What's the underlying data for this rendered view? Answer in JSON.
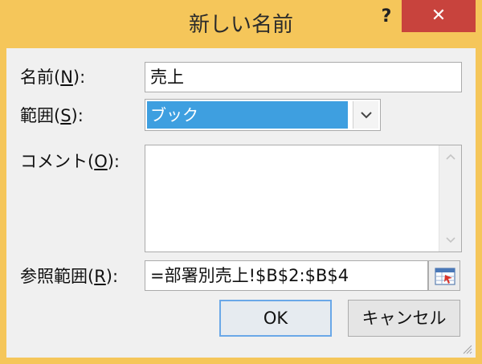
{
  "window": {
    "title": "新しい名前",
    "help": "?",
    "close": "✕"
  },
  "form": {
    "name": {
      "label_pre": "名前(",
      "label_key": "N",
      "label_post": "):",
      "value": "売上"
    },
    "scope": {
      "label_pre": "範囲(",
      "label_key": "S",
      "label_post": "):",
      "value": "ブック"
    },
    "comment": {
      "label_pre": "コメント(",
      "label_key": "O",
      "label_post": "):",
      "value": ""
    },
    "refers_to": {
      "label_pre": "参照範囲(",
      "label_key": "R",
      "label_post": "):",
      "value": "=部署別売上!$B$2:$B$4"
    }
  },
  "buttons": {
    "ok": "OK",
    "cancel": "キャンセル"
  },
  "colors": {
    "titlebar": "#f5c65a",
    "close": "#c8433d",
    "selection": "#3e9fe0"
  }
}
